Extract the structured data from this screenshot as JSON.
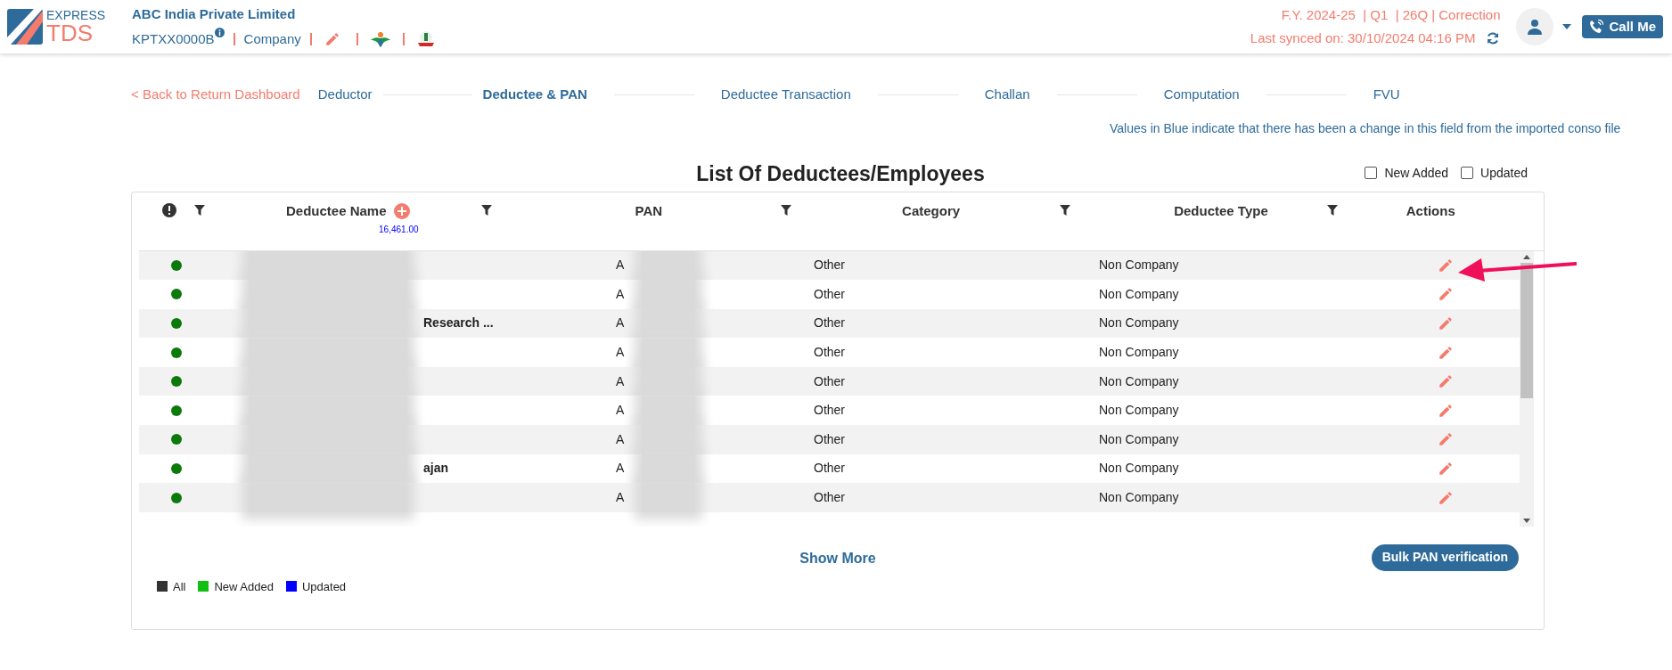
{
  "header": {
    "brand_top": "EXPRESS",
    "brand_bottom": "TDS",
    "company_name": "ABC India Private Limited",
    "tan": "KPTXX0000B",
    "entity": "Company",
    "return_info": "F.Y. 2024-25  | Q1  | 26Q | Correction",
    "last_synced": "Last synced on: 30/10/2024 04:16 PM",
    "call_button": "Call Me"
  },
  "back_link": "< Back to Return Dashboard",
  "steps": [
    {
      "label": "Deductor",
      "selected": false
    },
    {
      "label": "Deductee & PAN",
      "selected": true
    },
    {
      "label": "Deductee Transaction",
      "selected": false
    },
    {
      "label": "Challan",
      "selected": false
    },
    {
      "label": "Computation",
      "selected": false
    },
    {
      "label": "FVU",
      "selected": false
    }
  ],
  "note": "Values in Blue indicate that there has been a change in this field from the imported conso file",
  "title": "List Of Deductees/Employees",
  "filters": [
    {
      "label": "New Added",
      "checked": false
    },
    {
      "label": "Updated",
      "checked": false
    }
  ],
  "columns": {
    "name": "Deductee Name",
    "name_total": "16,461.00",
    "pan": "PAN",
    "category": "Category",
    "type": "Deductee Type",
    "actions": "Actions"
  },
  "rows": [
    {
      "color": "#0b7a0b",
      "pan": "A",
      "category": "Other",
      "type": "Non Company"
    },
    {
      "color": "#0b7a0b",
      "pan": "A",
      "category": "Other",
      "type": "Non Company"
    },
    {
      "color": "#0b7a0b",
      "name": "Research ...",
      "pan": "A",
      "category": "Other",
      "type": "Non Company"
    },
    {
      "color": "#0b7a0b",
      "pan": "A",
      "category": "Other",
      "type": "Non Company"
    },
    {
      "color": "#0b7a0b",
      "pan": "A",
      "category": "Other",
      "type": "Non Company"
    },
    {
      "color": "#0b7a0b",
      "pan": "A",
      "category": "Other",
      "type": "Non Company"
    },
    {
      "color": "#0b7a0b",
      "pan": "A",
      "category": "Other",
      "type": "Non Company"
    },
    {
      "color": "#0b7a0b",
      "name": "ajan",
      "pan": "A",
      "category": "Other",
      "type": "Non Company"
    },
    {
      "color": "#0b7a0b",
      "pan": "A",
      "category": "Other",
      "type": "Non Company"
    }
  ],
  "show_more": "Show More",
  "bulk_button": "Bulk PAN verification",
  "legend": [
    {
      "label": "All",
      "color": "#333333"
    },
    {
      "label": "New Added",
      "color": "#11c011"
    },
    {
      "label": "Updated",
      "color": "#0000ff"
    }
  ]
}
